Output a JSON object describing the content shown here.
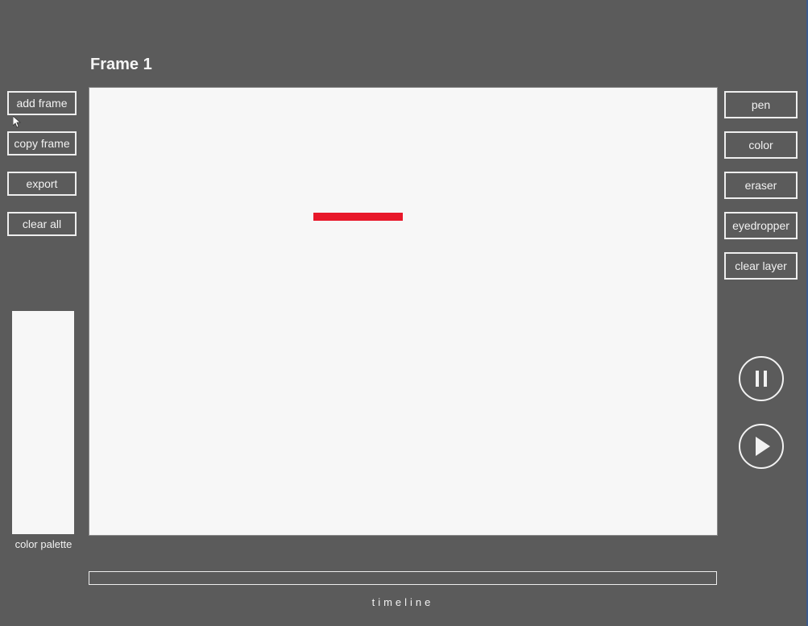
{
  "frame": {
    "title": "Frame 1"
  },
  "left_toolbar": {
    "add_frame": "add frame",
    "copy_frame": "copy frame",
    "export": "export",
    "clear_all": "clear all"
  },
  "right_toolbar": {
    "pen": "pen",
    "color": "color",
    "eraser": "eraser",
    "eyedropper": "eyedropper",
    "clear_layer": "clear layer"
  },
  "palette": {
    "label": "color palette"
  },
  "timeline": {
    "label": "timeline"
  },
  "playback": {
    "pause_icon": "pause-icon",
    "play_icon": "play-icon"
  },
  "colors": {
    "background": "#5b5b5b",
    "canvas": "#f7f7f7",
    "stroke": "#e8182a",
    "ui_line": "#eeeeee"
  }
}
